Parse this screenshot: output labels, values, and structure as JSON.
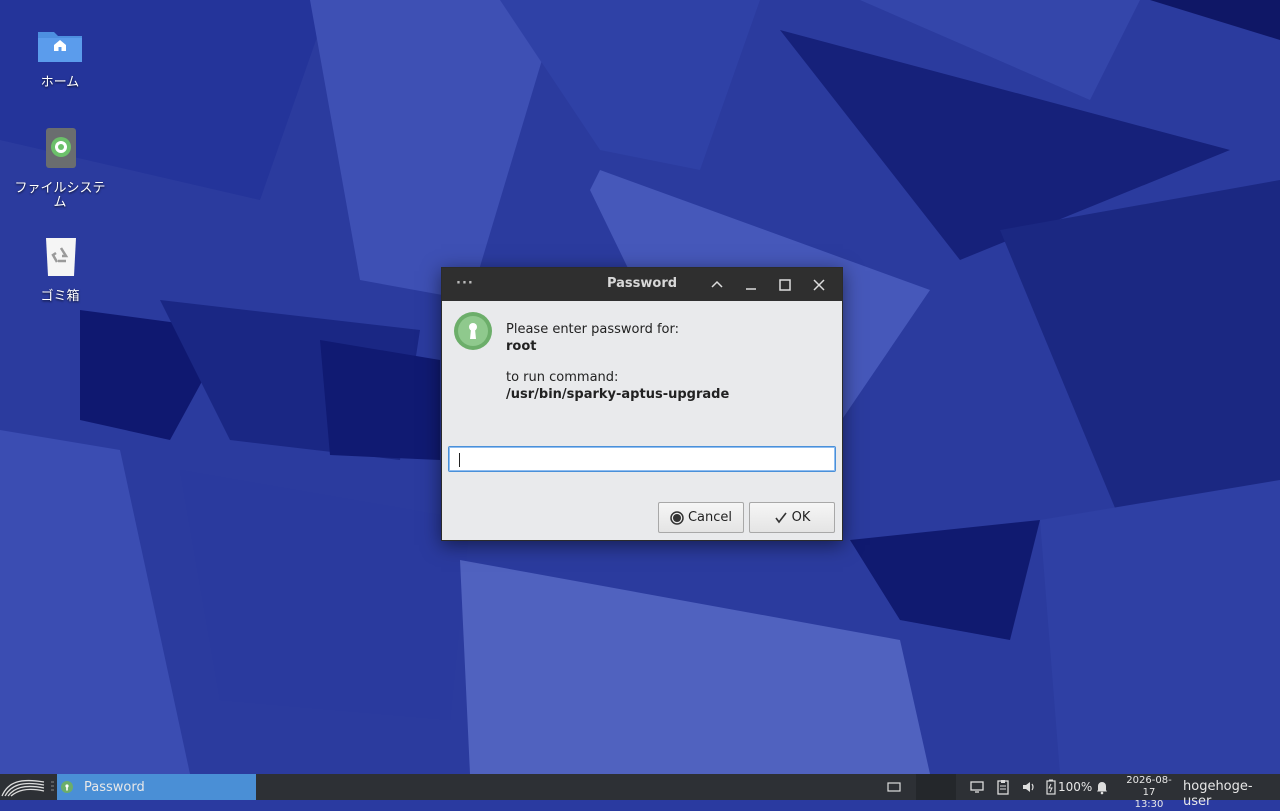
{
  "desktop": {
    "icons": [
      {
        "label": "ホーム",
        "icon": "home-folder-icon"
      },
      {
        "label": "ファイルシステム",
        "icon": "filesystem-drive-icon"
      },
      {
        "label": "ゴミ箱",
        "icon": "trash-icon"
      }
    ]
  },
  "dialog": {
    "title": "Password",
    "menu_glyph": "···",
    "prompt_line1": "Please enter password for:",
    "user": "root",
    "prompt_line2": "to run command:",
    "command": "/usr/bin/sparky-aptus-upgrade",
    "password_value": "",
    "cancel_label": "Cancel",
    "ok_label": "OK"
  },
  "taskbar": {
    "task_label": "Password",
    "battery": "100%",
    "date": "2026-08-17",
    "time": "13:30",
    "user": "hogehoge-user"
  },
  "colors": {
    "wallpaper": "#2a3aa0",
    "titlebar": "#2f2f2f",
    "dialog_bg": "#e9eaec",
    "taskbar": "#2d3035",
    "task_active": "#4a8fd6",
    "focus": "#4a90d9"
  }
}
